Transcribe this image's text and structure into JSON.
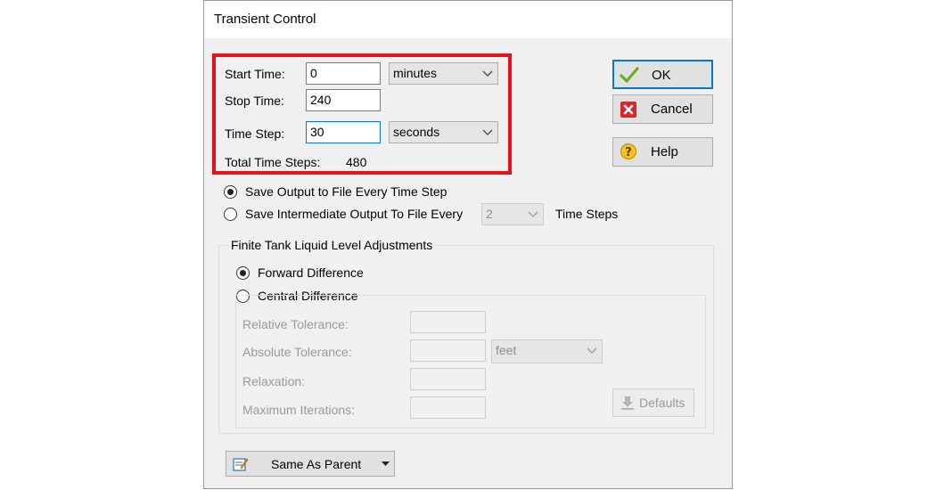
{
  "dialog": {
    "title": "Transient Control"
  },
  "time": {
    "start_label": "Start Time:",
    "start_value": "0",
    "start_units": "minutes",
    "stop_label": "Stop Time:",
    "stop_value": "240",
    "step_label": "Time Step:",
    "step_value": "30",
    "step_units": "seconds",
    "total_label": "Total Time Steps:",
    "total_value": "480"
  },
  "buttons": {
    "ok": "OK",
    "cancel": "Cancel",
    "help": "Help",
    "defaults": "Defaults",
    "same_as_parent": "Same As Parent"
  },
  "output": {
    "opt_every_step": "Save Output to File Every Time Step",
    "opt_intermediate": "Save Intermediate Output To File Every",
    "intermediate_value": "2",
    "intermediate_units": "Time Steps",
    "selected": "every_step"
  },
  "finite_tank": {
    "legend": "Finite Tank Liquid Level Adjustments",
    "opt_forward": "Forward Difference",
    "opt_central": "Central Difference",
    "selected": "forward",
    "relative_tolerance_label": "Relative Tolerance:",
    "absolute_tolerance_label": "Absolute Tolerance:",
    "absolute_units": "feet",
    "relaxation_label": "Relaxation:",
    "max_iterations_label": "Maximum Iterations:"
  },
  "colors": {
    "highlight_box": "#e8101a",
    "focus_border": "#0078d7",
    "disabled_text": "#9a9a9a"
  }
}
